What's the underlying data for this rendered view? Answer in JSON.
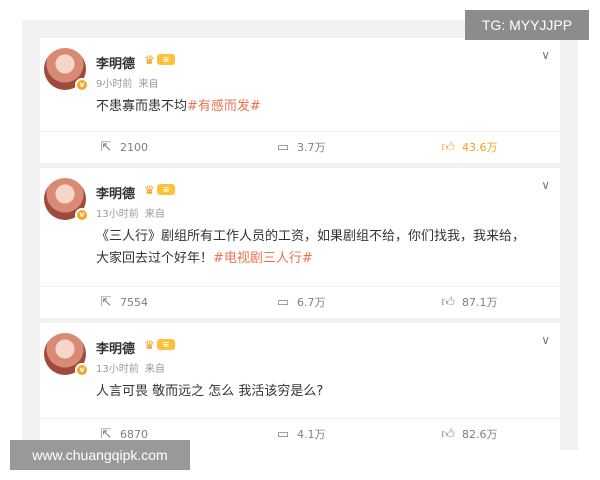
{
  "watermarks": {
    "tg": "TG: MYYJJPP",
    "site": "www.chuangqipk.com"
  },
  "colors": {
    "topic": "#eb7350",
    "liked": "#f0a020",
    "muted": "#808080"
  },
  "posts": [
    {
      "username": "李明德",
      "time": "9小时前",
      "source": "来自",
      "text": "不患寡而患不均",
      "topic": "#有感而发#",
      "reposts": "2100",
      "comments": "3.7万",
      "likes": "43.6万",
      "liked": true
    },
    {
      "username": "李明德",
      "time": "13小时前",
      "source": "来自",
      "text": "《三人行》剧组所有工作人员的工资，如果剧组不给，你们找我，我来给，大家回去过个好年！",
      "topic": "#电视剧三人行#",
      "reposts": "7554",
      "comments": "6.7万",
      "likes": "87.1万",
      "liked": false
    },
    {
      "username": "李明德",
      "time": "13小时前",
      "source": "来自",
      "text": "人言可畏 敬而远之  怎么 我活该穷是么?",
      "topic": "",
      "reposts": "6870",
      "comments": "4.1万",
      "likes": "82.6万",
      "liked": false
    }
  ],
  "icons": {
    "repost": "repost-icon",
    "comment": "comment-icon",
    "like": "like-icon",
    "menu": "chevron-down-icon",
    "crown": "crown-icon"
  }
}
